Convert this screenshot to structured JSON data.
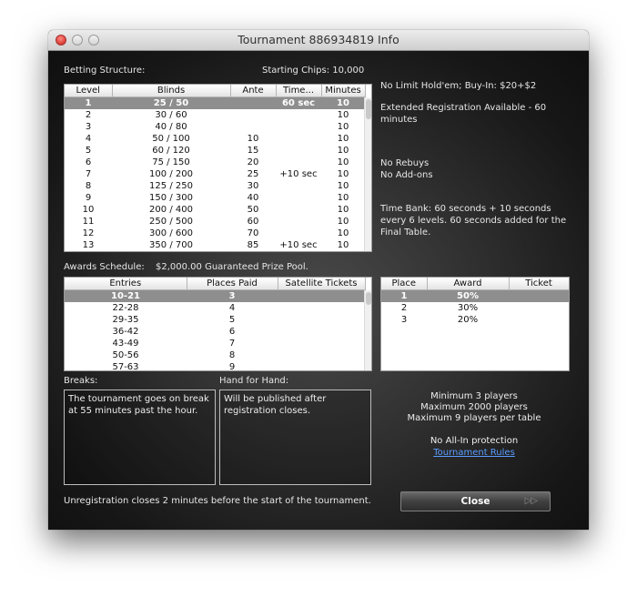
{
  "window": {
    "title": "Tournament 886934819 Info"
  },
  "betting": {
    "label": "Betting Structure:",
    "starting_chips": "Starting Chips: 10,000",
    "columns": [
      "Level",
      "Blinds",
      "Ante",
      "Time...",
      "Minutes"
    ],
    "rows": [
      [
        "1",
        "25 / 50",
        "",
        "60 sec",
        "10"
      ],
      [
        "2",
        "30 / 60",
        "",
        "",
        "10"
      ],
      [
        "3",
        "40 / 80",
        "",
        "",
        "10"
      ],
      [
        "4",
        "50 / 100",
        "10",
        "",
        "10"
      ],
      [
        "5",
        "60 / 120",
        "15",
        "",
        "10"
      ],
      [
        "6",
        "75 / 150",
        "20",
        "",
        "10"
      ],
      [
        "7",
        "100 / 200",
        "25",
        "+10 sec",
        "10"
      ],
      [
        "8",
        "125 / 250",
        "30",
        "",
        "10"
      ],
      [
        "9",
        "150 / 300",
        "40",
        "",
        "10"
      ],
      [
        "10",
        "200 / 400",
        "50",
        "",
        "10"
      ],
      [
        "11",
        "250 / 500",
        "60",
        "",
        "10"
      ],
      [
        "12",
        "300 / 600",
        "70",
        "",
        "10"
      ],
      [
        "13",
        "350 / 700",
        "85",
        "+10 sec",
        "10"
      ]
    ]
  },
  "info": {
    "game": "No Limit Hold'em; Buy-In: $20+$2",
    "extended": "Extended Registration Available - 60 minutes",
    "rebuys": "No Rebuys",
    "addons": "No Add-ons",
    "timebank": "Time Bank: 60 seconds + 10 seconds every 6 levels. 60 seconds added for the Final Table."
  },
  "awards": {
    "label": "Awards Schedule:",
    "prize": "$2,000.00 Guaranteed Prize Pool.",
    "columns": [
      "Entries",
      "Places Paid",
      "Satellite Tickets"
    ],
    "rows": [
      [
        "10-21",
        "3",
        ""
      ],
      [
        "22-28",
        "4",
        ""
      ],
      [
        "29-35",
        "5",
        ""
      ],
      [
        "36-42",
        "6",
        ""
      ],
      [
        "43-49",
        "7",
        ""
      ],
      [
        "50-56",
        "8",
        ""
      ],
      [
        "57-63",
        "9",
        ""
      ]
    ]
  },
  "places": {
    "columns": [
      "Place",
      "Award",
      "Ticket"
    ],
    "rows": [
      [
        "1",
        "50%",
        ""
      ],
      [
        "2",
        "30%",
        ""
      ],
      [
        "3",
        "20%",
        ""
      ]
    ]
  },
  "breaks": {
    "label": "Breaks:",
    "text": "The tournament goes on break at 55 minutes past the hour."
  },
  "hand": {
    "label": "Hand for Hand:",
    "text": "Will be published after registration closes."
  },
  "limits": {
    "min": "Minimum 3 players",
    "max": "Maximum 2000 players",
    "table": "Maximum 9 players per table",
    "allin": "No All-In protection",
    "rules_link": "Tournament Rules"
  },
  "footer": {
    "unregistration": "Unregistration closes 2 minutes before the start of the tournament.",
    "close_label": "Close",
    "close_arrows": "▷▷"
  },
  "colors": {
    "selected_row": "#8e8e8e",
    "link": "#5a9cff",
    "close_red": "#e0443e"
  }
}
